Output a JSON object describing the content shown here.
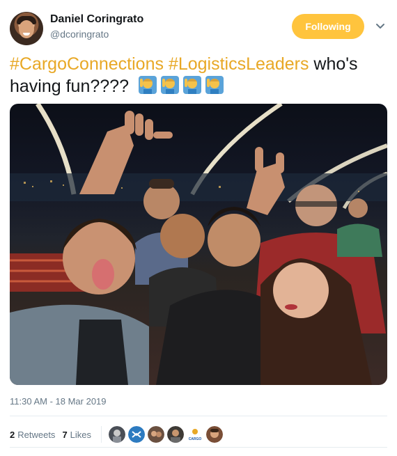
{
  "author": {
    "name": "Daniel Coringrato",
    "handle": "@dcoringrato"
  },
  "follow_button": {
    "label": "Following",
    "color": "#ffc43d"
  },
  "tweet": {
    "hashtag1": "#CargoConnections",
    "hashtag2": "#LogisticsLeaders",
    "text": "who's having fun????",
    "emoji_count": 4,
    "emoji_name": "man-raising-hand"
  },
  "timestamp": "11:30 AM - 18 Mar 2019",
  "stats": {
    "retweets_count": "2",
    "retweets_label": "Retweets",
    "likes_count": "7",
    "likes_label": "Likes"
  },
  "liker_avatars": [
    "avatar-1",
    "avatar-2",
    "avatar-3",
    "avatar-4",
    "avatar-cargo",
    "avatar-6"
  ],
  "cargo_avatar_text": "CARGO",
  "colors": {
    "hashtag": "#e8a826",
    "secondary_text": "#657786",
    "primary_text": "#14171a"
  }
}
